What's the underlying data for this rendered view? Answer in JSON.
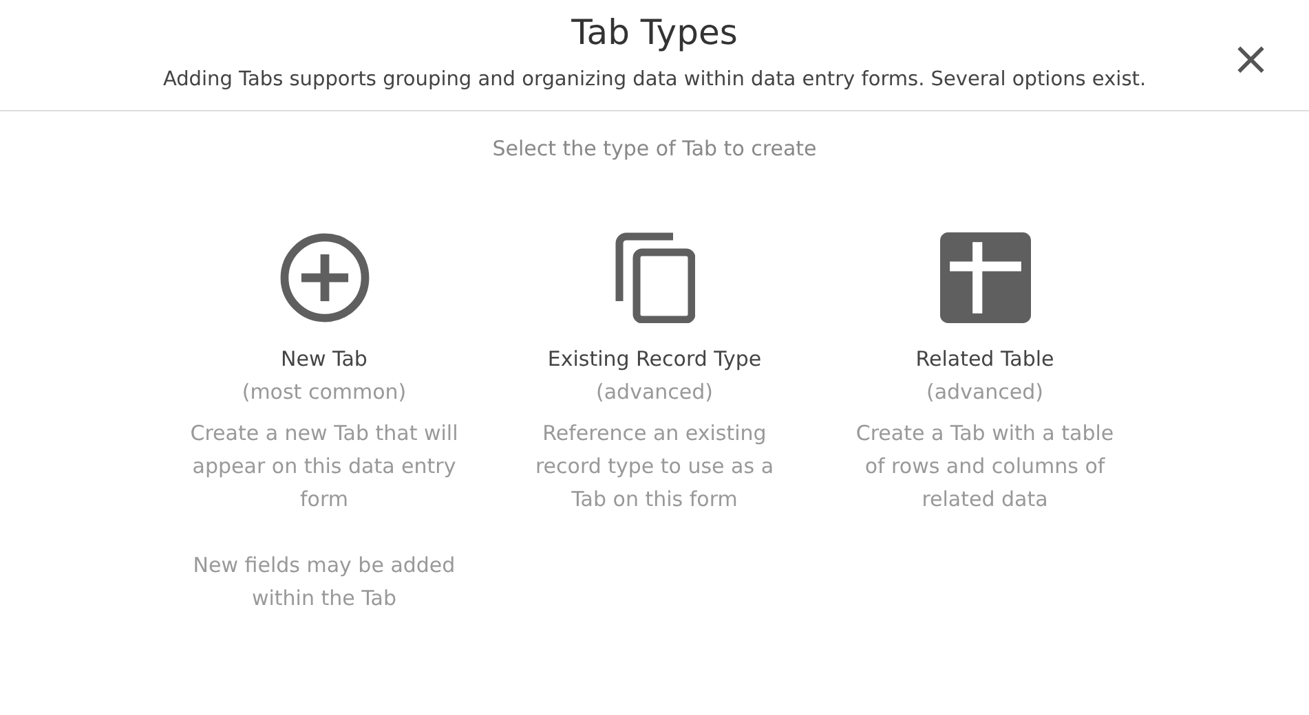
{
  "dialog": {
    "title": "Tab Types",
    "subtitle": "Adding Tabs supports grouping and organizing data within data entry forms. Several options exist.",
    "close": "×"
  },
  "prompt": "Select the type of Tab to create",
  "options": [
    {
      "kind": "new",
      "title": "New Tab",
      "note": "(most common)",
      "paragraphs": [
        "Create a new Tab that will appear on this data entry form",
        "New fields may be added within the Tab"
      ]
    },
    {
      "kind": "existing",
      "title": "Existing Record Type",
      "note": "(advanced)",
      "paragraphs": [
        "Reference an existing record type to use as a Tab on this form"
      ]
    },
    {
      "kind": "related",
      "title": "Related Table",
      "note": "(advanced)",
      "paragraphs": [
        "Create a Tab with a table of rows and columns of related data"
      ]
    }
  ]
}
